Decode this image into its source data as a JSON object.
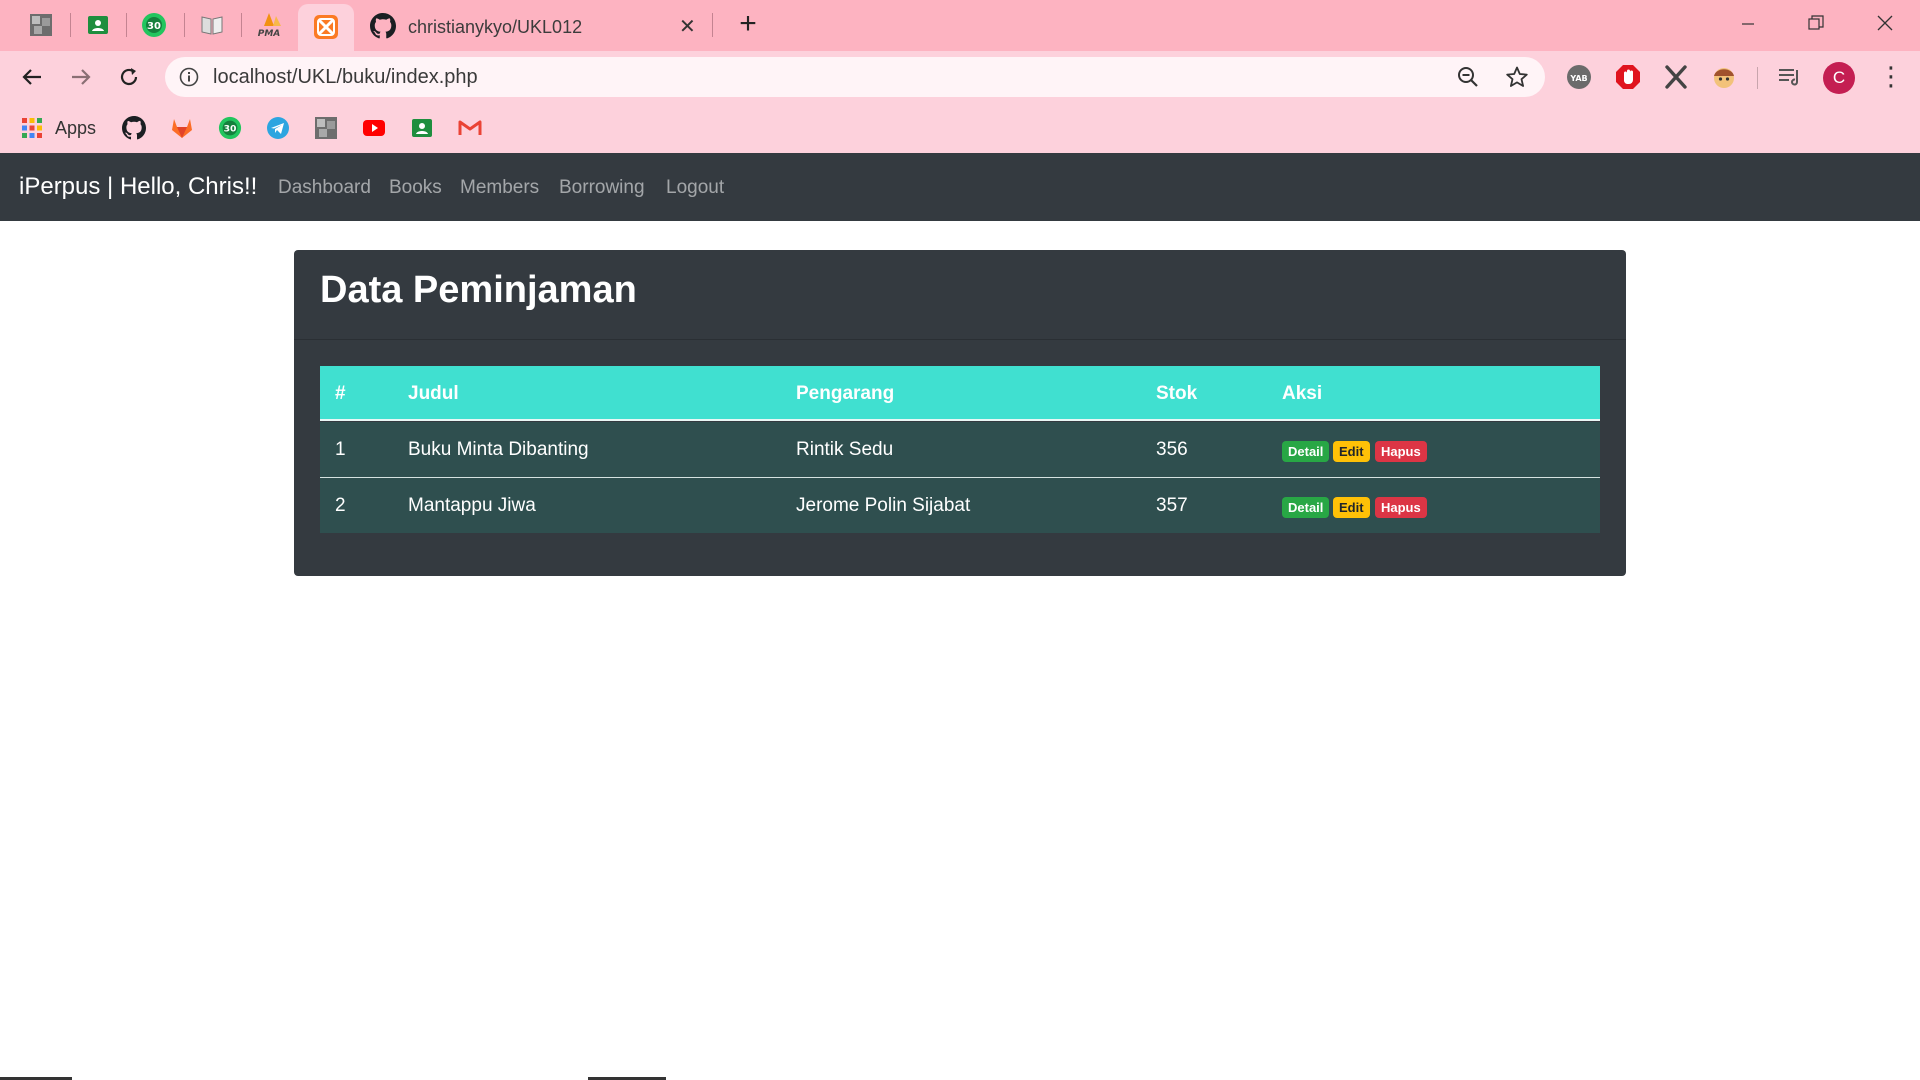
{
  "browser": {
    "tabs": [
      {
        "icon": "photo-avatar-icon"
      },
      {
        "icon": "google-classroom-icon"
      },
      {
        "icon": "green-30-icon"
      },
      {
        "icon": "book-icon"
      },
      {
        "icon": "phpmyadmin-icon",
        "icon_text": "PMA"
      },
      {
        "icon": "xampp-icon"
      },
      {
        "icon": "github-icon",
        "title": "christianykyo/UKL012"
      }
    ],
    "address": "localhost/UKL/buku/index.php",
    "profile_initial": "C",
    "bookmarks": [
      {
        "icon": "apps-grid-icon",
        "label": "Apps"
      },
      {
        "icon": "github-icon"
      },
      {
        "icon": "gitlab-icon"
      },
      {
        "icon": "green-30-icon"
      },
      {
        "icon": "telegram-icon"
      },
      {
        "icon": "photo-avatar-icon"
      },
      {
        "icon": "youtube-icon"
      },
      {
        "icon": "google-classroom-icon"
      },
      {
        "icon": "gmail-icon"
      }
    ],
    "extensions": [
      "yab-extension-icon",
      "adblock-icon",
      "x-extension-icon",
      "avatar-extension-icon",
      "media-queue-icon"
    ],
    "colors": {
      "tabstrip": "#fdb3c1",
      "toolbar": "#fdd1dc",
      "profile": "#c41e52"
    }
  },
  "navbar": {
    "brand": "iPerpus | Hello, Chris!!",
    "links": [
      "Dashboard",
      "Books",
      "Members",
      "Borrowing",
      "Logout"
    ]
  },
  "card": {
    "title": "Data Peminjaman",
    "table": {
      "headers": [
        "#",
        "Judul",
        "Pengarang",
        "Stok",
        "Aksi"
      ],
      "rows": [
        {
          "no": "1",
          "judul": "Buku Minta Dibanting",
          "pengarang": "Rintik Sedu",
          "stok": "356"
        },
        {
          "no": "2",
          "judul": "Mantappu Jiwa",
          "pengarang": "Jerome Polin Sijabat",
          "stok": "357"
        }
      ],
      "actions": {
        "detail": "Detail",
        "edit": "Edit",
        "hapus": "Hapus"
      }
    }
  },
  "colors": {
    "navbar": "#343a40",
    "table_header": "#40e0d0",
    "table_row": "#2f4f4f",
    "detail": "#28a745",
    "edit": "#ffc107",
    "hapus": "#dc3545"
  }
}
